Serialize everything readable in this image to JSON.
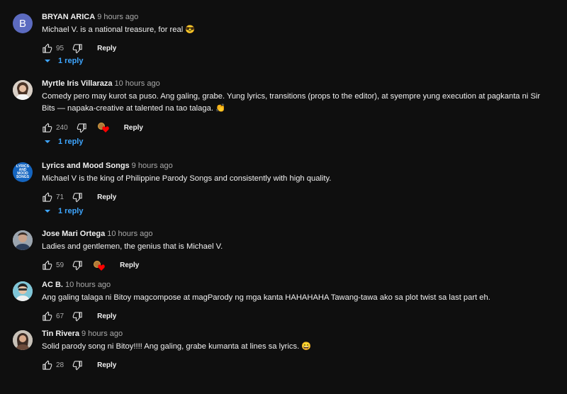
{
  "comments": [
    {
      "author": "BRYAN ARICA",
      "time": "9 hours ago",
      "text": "Michael V. is a national treasure, for real 😎",
      "likes": "95",
      "reply": "Reply",
      "replies": "1 reply",
      "avatar_letter": "B"
    },
    {
      "author": "Myrtle Iris Villaraza",
      "time": "10 hours ago",
      "text": "Comedy pero may kurot sa puso. Ang galing, grabe. Yung lyrics, transitions (props to the editor), at syempre yung execution at pagkanta ni Sir Bits — napaka-creative at talented na tao talaga. 👏",
      "likes": "240",
      "reply": "Reply",
      "replies": "1 reply"
    },
    {
      "author": "Lyrics and Mood Songs",
      "time": "9 hours ago",
      "text": "Michael V is the king of Philippine Parody Songs and consistently with high quality.",
      "likes": "71",
      "reply": "Reply",
      "replies": "1 reply",
      "avatar_text": "LYRICS AND MOOD SONGS"
    },
    {
      "author": "Jose Mari Ortega",
      "time": "10 hours ago",
      "text": "Ladies and gentlemen, the genius that is Michael V.",
      "likes": "59",
      "reply": "Reply"
    },
    {
      "author": "AC B.",
      "time": "10 hours ago",
      "text": "Ang galing talaga ni Bitoy magcompose at magParody ng mga kanta HAHAHAHA Tawang-tawa ako sa plot twist sa last part eh.",
      "likes": "67",
      "reply": "Reply"
    },
    {
      "author": "Tin Rivera",
      "time": "9 hours ago",
      "text": "Solid parody song ni Bitoy!!!! Ang galing, grabe kumanta at lines sa lyrics. 😄",
      "likes": "28",
      "reply": "Reply"
    }
  ],
  "icons": {
    "like": "thumbs-up-icon",
    "dislike": "thumbs-down-icon",
    "creator_heart": "creator-heart-icon",
    "expand": "chevron-down-icon"
  },
  "colors": {
    "background": "#0f0f0f",
    "link": "#3ea6ff",
    "text": "#f1f1f1",
    "muted": "#aaaaaa",
    "heart": "#ff0000"
  }
}
